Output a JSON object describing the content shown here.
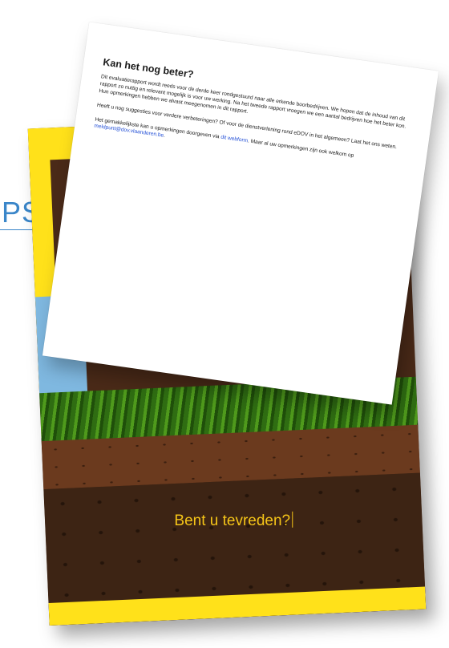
{
  "behind_page_text": "PS",
  "cover": {
    "tagline": "Bent u tevreden?"
  },
  "page": {
    "title": "Kan het nog beter?",
    "paragraph1": "Dit evaluatierapport wordt reeds voor de derde keer rondgestuurd naar alle erkende boorbedrijven. We hopen dat de inhoud van dit rapport zo nuttig en relevant mogelijk is voor uw werking. Na het tweede rapport vroegen we een aantal bedrijven hoe het beter kon. Hun opmerkingen hebben we alvast meegenomen in dit rapport.",
    "paragraph2": "Heeft u nog suggesties voor verdere verbeteringen? Of voor de dienstverlening rond eDOV in het algemeen? Laat het ons weten.",
    "paragraph3_before": "Het gemakkelijkste kan u opmerkingen doorgeven via ",
    "webform_link": "dit webform",
    "paragraph3_middle": ". Maar al uw opmerkingen zijn ook welkom op ",
    "email_link": "meldpunt@dov.vlaanderen.be",
    "paragraph3_end": "."
  },
  "colors": {
    "yellow": "#ffe11a",
    "soil_dark": "#3d2414",
    "link": "#2450d6",
    "tagline": "#f5c518"
  }
}
